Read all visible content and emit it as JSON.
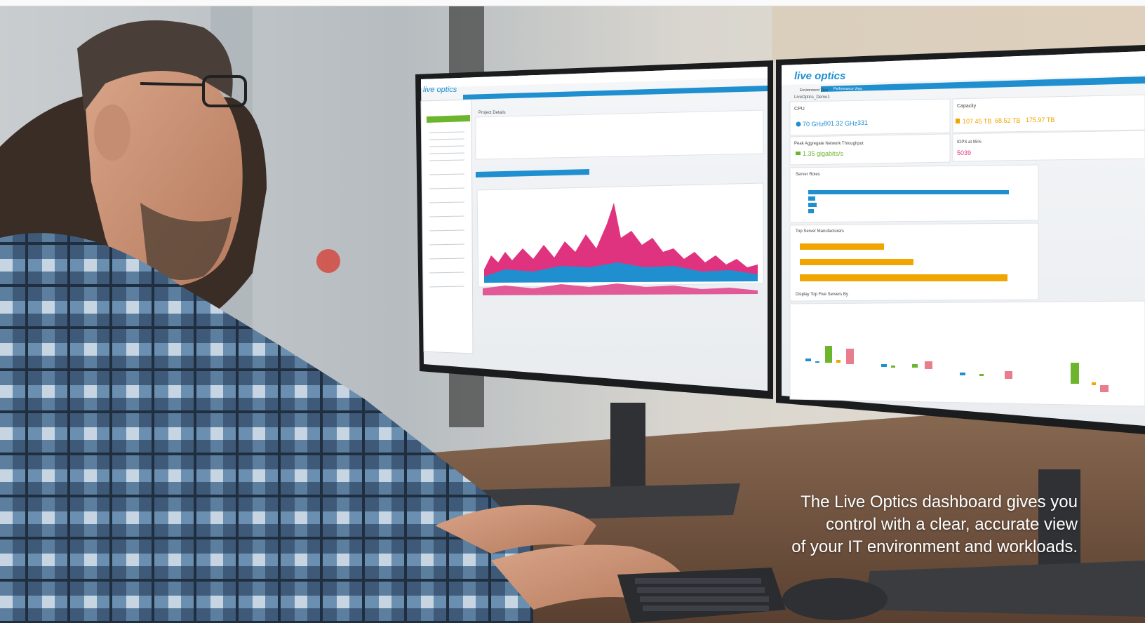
{
  "left_monitor": {
    "logo_text": "live optics",
    "panel_title": "Project Details"
  },
  "right_monitor": {
    "logo_text": "live optics",
    "tabs": [
      "Environment View",
      "Performance View"
    ],
    "project_name": "LiveOptics_Demo1",
    "cpu": {
      "title": "CPU",
      "peak_value": "70 GHz",
      "net_value": "801.32 GHz",
      "cores_value": "331"
    },
    "capacity": {
      "title": "Capacity",
      "used": "107.45 TB",
      "free": "68.52 TB",
      "total": "175.97 TB"
    },
    "throughput": {
      "title": "Peak Aggregate Network Throughput",
      "value": "1.35 gigabits/s"
    },
    "iops": {
      "title": "IOPS at 95%",
      "value": "5039"
    },
    "server_roles_title": "Server Roles",
    "top_manufacturers_title": "Top Server Manufacturers",
    "top_five_title": "Display Top Five Servers By"
  },
  "caption": {
    "line1": "The Live Optics dashboard gives you",
    "line2": "control with a clear, accurate view",
    "line3": "of your IT environment and workloads."
  },
  "colors": {
    "accent_blue": "#1f8fcf",
    "accent_pink": "#e0337f",
    "accent_orange": "#f0a500",
    "accent_green": "#6cb52d"
  }
}
